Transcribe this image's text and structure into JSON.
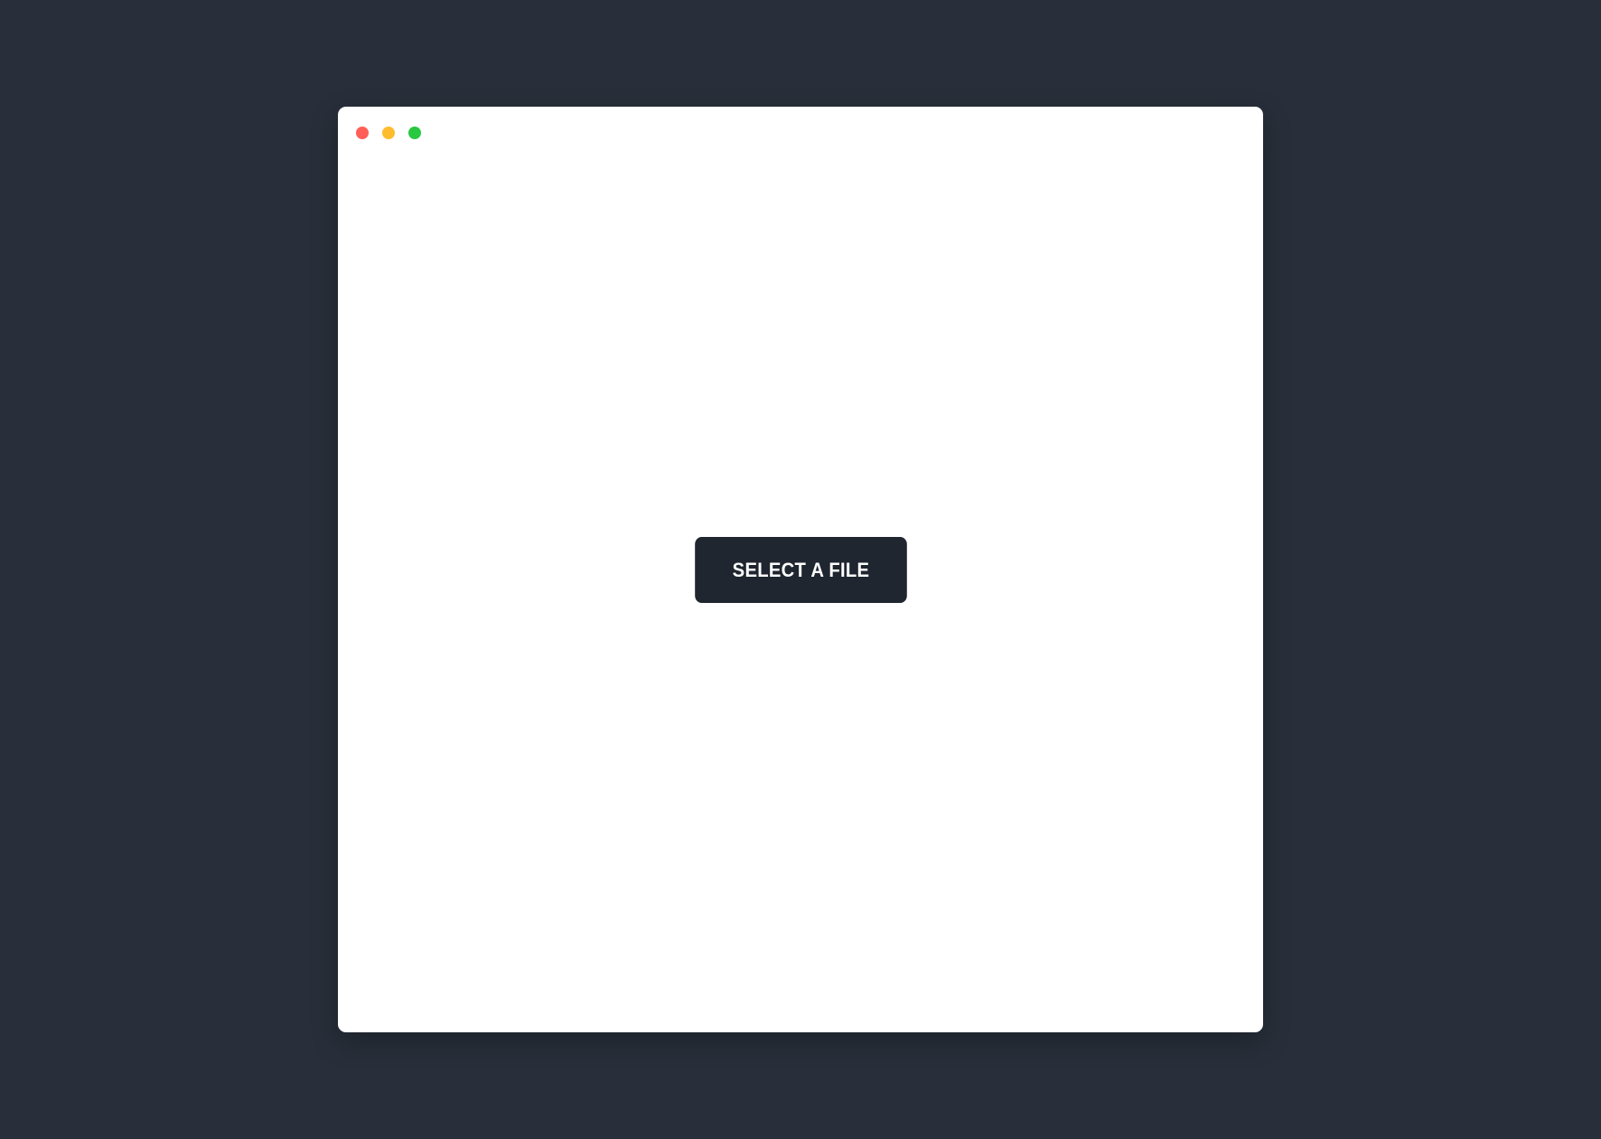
{
  "colors": {
    "background": "#282f3a",
    "window": "#ffffff",
    "button": "#1f2630",
    "button_text": "#ffffff",
    "close": "#ff5f57",
    "minimize": "#febc2e",
    "zoom": "#28c840"
  },
  "window": {
    "controls": [
      {
        "name": "close-button",
        "icon": "close-dot-icon",
        "color": "#ff5f57"
      },
      {
        "name": "minimize-button",
        "icon": "minimize-dot-icon",
        "color": "#febc2e"
      },
      {
        "name": "zoom-button",
        "icon": "zoom-dot-icon",
        "color": "#28c840"
      }
    ]
  },
  "main": {
    "select_file_label": "SELECT A FILE"
  }
}
